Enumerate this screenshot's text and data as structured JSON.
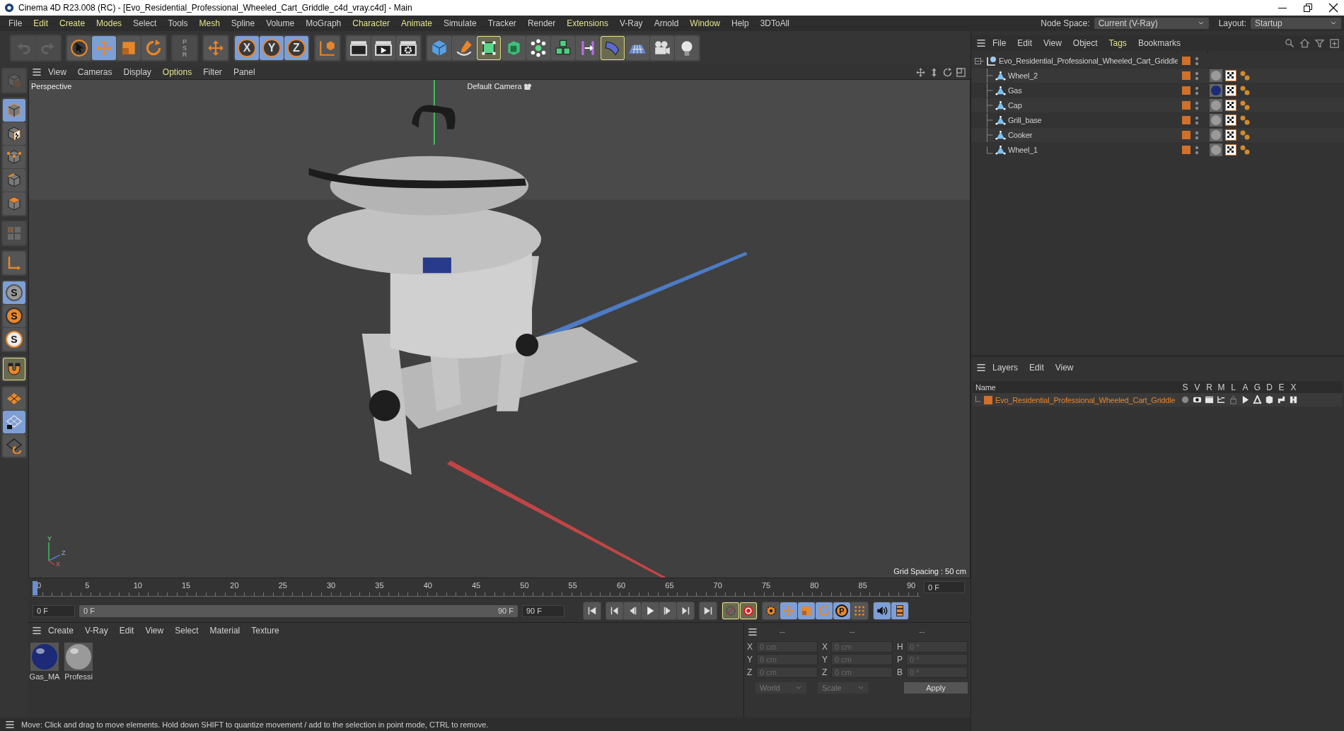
{
  "window": {
    "title": "Cinema 4D R23.008 (RC) - [Evo_Residential_Professional_Wheeled_Cart_Griddle_c4d_vray.c4d] - Main"
  },
  "menu": [
    {
      "label": "File",
      "accent": false
    },
    {
      "label": "Edit",
      "accent": true
    },
    {
      "label": "Create",
      "accent": true
    },
    {
      "label": "Modes",
      "accent": true
    },
    {
      "label": "Select",
      "accent": false
    },
    {
      "label": "Tools",
      "accent": false
    },
    {
      "label": "Mesh",
      "accent": true
    },
    {
      "label": "Spline",
      "accent": false
    },
    {
      "label": "Volume",
      "accent": false
    },
    {
      "label": "MoGraph",
      "accent": false
    },
    {
      "label": "Character",
      "accent": true
    },
    {
      "label": "Animate",
      "accent": true
    },
    {
      "label": "Simulate",
      "accent": false
    },
    {
      "label": "Tracker",
      "accent": false
    },
    {
      "label": "Render",
      "accent": false
    },
    {
      "label": "Extensions",
      "accent": true
    },
    {
      "label": "V-Ray",
      "accent": false
    },
    {
      "label": "Arnold",
      "accent": false
    },
    {
      "label": "Window",
      "accent": true
    },
    {
      "label": "Help",
      "accent": false
    },
    {
      "label": "3DToAll",
      "accent": false
    }
  ],
  "node_space": {
    "label": "Node Space:",
    "value": "Current (V-Ray)"
  },
  "layout": {
    "label": "Layout:",
    "value": "Startup"
  },
  "toolbar": [
    {
      "items": [
        {
          "kind": "undo",
          "selected": false,
          "active": false,
          "disabled": true
        },
        {
          "kind": "redo",
          "selected": false,
          "active": false,
          "disabled": true
        }
      ]
    },
    {
      "items": [
        {
          "kind": "cursor",
          "selected": false,
          "active": false,
          "disabled": false
        },
        {
          "kind": "move",
          "selected": true,
          "active": false,
          "disabled": false
        },
        {
          "kind": "scale",
          "selected": false,
          "active": false,
          "disabled": false
        },
        {
          "kind": "rotate",
          "selected": false,
          "active": false,
          "disabled": false
        }
      ]
    },
    {
      "items": [
        {
          "kind": "psr",
          "label": "PSR",
          "selected": false,
          "active": false,
          "disabled": true
        }
      ]
    },
    {
      "items": [
        {
          "kind": "move",
          "selected": false,
          "active": false,
          "disabled": false
        }
      ]
    },
    {
      "items": [
        {
          "kind": "axis",
          "label": "X",
          "selected": true,
          "active": false,
          "disabled": false
        },
        {
          "kind": "axis",
          "label": "Y",
          "selected": true,
          "active": false,
          "disabled": false
        },
        {
          "kind": "axis",
          "label": "Z",
          "selected": true,
          "active": false,
          "disabled": false
        }
      ]
    },
    {
      "items": [
        {
          "kind": "cube-axis",
          "selected": false,
          "active": false,
          "disabled": false
        }
      ]
    },
    {
      "items": [
        {
          "kind": "clapper",
          "selected": false,
          "active": false,
          "disabled": false
        },
        {
          "kind": "play-clapper",
          "selected": false,
          "active": false,
          "disabled": false
        },
        {
          "kind": "gear-clapper",
          "selected": false,
          "active": false,
          "disabled": false
        }
      ]
    },
    {
      "items": [
        {
          "kind": "cube",
          "selected": false,
          "active": false,
          "disabled": false
        },
        {
          "kind": "pen",
          "selected": false,
          "active": false,
          "disabled": false
        },
        {
          "kind": "subdivision",
          "selected": false,
          "active": true,
          "disabled": false
        },
        {
          "kind": "extrude",
          "selected": false,
          "active": false,
          "disabled": false
        },
        {
          "kind": "cloner",
          "selected": false,
          "active": false,
          "disabled": false
        },
        {
          "kind": "cubes",
          "selected": false,
          "active": false,
          "disabled": false
        },
        {
          "kind": "symmetry",
          "selected": false,
          "active": false,
          "disabled": false
        },
        {
          "kind": "deformer",
          "selected": false,
          "active": true,
          "disabled": false
        },
        {
          "kind": "floor",
          "selected": false,
          "active": false,
          "disabled": false
        },
        {
          "kind": "camera",
          "selected": false,
          "active": false,
          "disabled": false
        },
        {
          "kind": "light",
          "selected": false,
          "active": false,
          "disabled": false
        }
      ]
    }
  ],
  "side_toolbar": [
    {
      "items": [
        {
          "kind": "make-editable",
          "selected": false,
          "active": false,
          "disabled": true
        }
      ]
    },
    {
      "items": [
        {
          "kind": "model",
          "selected": true,
          "active": false,
          "disabled": false
        },
        {
          "kind": "texture",
          "selected": false,
          "active": false,
          "disabled": false
        },
        {
          "kind": "points",
          "selected": false,
          "active": false,
          "disabled": false
        },
        {
          "kind": "edges",
          "selected": false,
          "active": false,
          "disabled": false
        },
        {
          "kind": "polygons",
          "selected": false,
          "active": false,
          "disabled": false
        }
      ]
    },
    {
      "items": [
        {
          "kind": "uv",
          "selected": false,
          "active": false,
          "disabled": true
        }
      ]
    },
    {
      "items": [
        {
          "kind": "axis-l",
          "selected": false,
          "active": false,
          "disabled": false
        }
      ]
    },
    {
      "items": [
        {
          "kind": "snap-grey",
          "label": "S",
          "selected": true,
          "active": false,
          "disabled": false
        },
        {
          "kind": "snap-orange",
          "label": "S",
          "selected": false,
          "active": false,
          "disabled": false
        },
        {
          "kind": "snap-white",
          "label": "S",
          "selected": false,
          "active": false,
          "disabled": false
        }
      ]
    },
    {
      "items": [
        {
          "kind": "magnet",
          "selected": false,
          "active": true,
          "disabled": false
        }
      ]
    },
    {
      "items": [
        {
          "kind": "workplane",
          "selected": false,
          "active": false,
          "disabled": false
        },
        {
          "kind": "workplane-lock",
          "selected": true,
          "active": false,
          "disabled": false
        },
        {
          "kind": "workplane-sync",
          "selected": false,
          "active": false,
          "disabled": false
        }
      ]
    }
  ],
  "viewport": {
    "menu": [
      "View",
      "Cameras",
      "Display",
      "Options",
      "Filter",
      "Panel"
    ],
    "menu_accent": [
      false,
      false,
      false,
      true,
      false,
      false
    ],
    "camera_mode": "Perspective",
    "camera": "Default Camera",
    "grid_spacing": "Grid Spacing : 50 cm",
    "axis_labels": [
      "Y",
      "Z",
      "X"
    ]
  },
  "timeline": {
    "ticks": [
      "0",
      "5",
      "10",
      "15",
      "20",
      "25",
      "30",
      "35",
      "40",
      "45",
      "50",
      "55",
      "60",
      "65",
      "70",
      "75",
      "80",
      "85",
      "90"
    ],
    "current_frame": "0 F",
    "start": "0 F",
    "range_start": "0 F",
    "range_end": "90 F",
    "end": "90 F",
    "buttons": [
      {
        "items": [
          {
            "kind": "to-start",
            "selected": false,
            "active": false
          }
        ]
      },
      {
        "items": [
          {
            "kind": "prev-key",
            "selected": false,
            "active": false
          },
          {
            "kind": "prev-frame",
            "selected": false,
            "active": false
          },
          {
            "kind": "play",
            "selected": false,
            "active": false
          },
          {
            "kind": "next-frame",
            "selected": false,
            "active": false
          },
          {
            "kind": "next-key",
            "selected": false,
            "active": false
          }
        ]
      },
      {
        "items": [
          {
            "kind": "to-end",
            "selected": false,
            "active": false
          }
        ]
      },
      {
        "items": [
          {
            "kind": "record-auto",
            "selected": false,
            "active": true
          },
          {
            "kind": "record",
            "selected": false,
            "active": true
          }
        ]
      },
      {
        "items": [
          {
            "kind": "key",
            "selected": false,
            "active": false
          },
          {
            "kind": "move",
            "selected": true,
            "active": false
          },
          {
            "kind": "scale",
            "selected": true,
            "active": false
          },
          {
            "kind": "rotate",
            "selected": true,
            "active": false
          },
          {
            "kind": "p-key",
            "label": "P",
            "selected": true,
            "active": false
          },
          {
            "kind": "dots",
            "selected": false,
            "active": false
          }
        ]
      },
      {
        "items": [
          {
            "kind": "sound",
            "selected": true,
            "active": false
          },
          {
            "kind": "film",
            "selected": true,
            "active": false
          }
        ]
      }
    ]
  },
  "materials": {
    "menu": [
      "Create",
      "V-Ray",
      "Edit",
      "View",
      "Select",
      "Material",
      "Texture"
    ],
    "items": [
      {
        "name": "Gas_MA",
        "color": "#1c2a78"
      },
      {
        "name": "Professi",
        "color": "#9a9a9a"
      }
    ]
  },
  "coordinates": {
    "headers": [
      "--",
      "--",
      "--"
    ],
    "rows": [
      {
        "cells": [
          {
            "axis": "X",
            "value": "0 cm"
          },
          {
            "axis": "X",
            "value": "0 cm"
          },
          {
            "axis": "H",
            "value": "0 °"
          }
        ]
      },
      {
        "cells": [
          {
            "axis": "Y",
            "value": "0 cm"
          },
          {
            "axis": "Y",
            "value": "0 cm"
          },
          {
            "axis": "P",
            "value": "0 °"
          }
        ]
      },
      {
        "cells": [
          {
            "axis": "Z",
            "value": "0 cm"
          },
          {
            "axis": "Z",
            "value": "0 cm"
          },
          {
            "axis": "B",
            "value": "0 °"
          }
        ]
      }
    ],
    "dropdowns": [
      "World",
      "Scale"
    ],
    "apply": "Apply"
  },
  "status_bar": "Move: Click and drag to move elements. Hold down SHIFT to quantize movement / add to the selection in point mode, CTRL to remove.",
  "object_manager": {
    "menu": [
      {
        "label": "File",
        "accent": false
      },
      {
        "label": "Edit",
        "accent": false
      },
      {
        "label": "View",
        "accent": false
      },
      {
        "label": "Object",
        "accent": false
      },
      {
        "label": "Tags",
        "accent": true
      },
      {
        "label": "Bookmarks",
        "accent": false
      }
    ],
    "tree": {
      "name": "Evo_Residential_Professional_Wheeled_Cart_Griddle",
      "expanded": true,
      "children": [
        {
          "name": "Wheel_2",
          "color": "#9a9a9a"
        },
        {
          "name": "Gas",
          "color": "#1c2a78"
        },
        {
          "name": "Cap",
          "color": "#9a9a9a"
        },
        {
          "name": "Grill_base",
          "color": "#9a9a9a"
        },
        {
          "name": "Cooker",
          "color": "#9a9a9a"
        },
        {
          "name": "Wheel_1",
          "color": "#9a9a9a"
        }
      ]
    }
  },
  "layers": {
    "menu": [
      "Layers",
      "Edit",
      "View"
    ],
    "columns": [
      "Name",
      "S",
      "V",
      "R",
      "M",
      "L",
      "A",
      "G",
      "D",
      "E",
      "X"
    ],
    "rows": [
      {
        "name": "Evo_Residential_Professional_Wheeled_Cart_Griddle"
      }
    ]
  }
}
